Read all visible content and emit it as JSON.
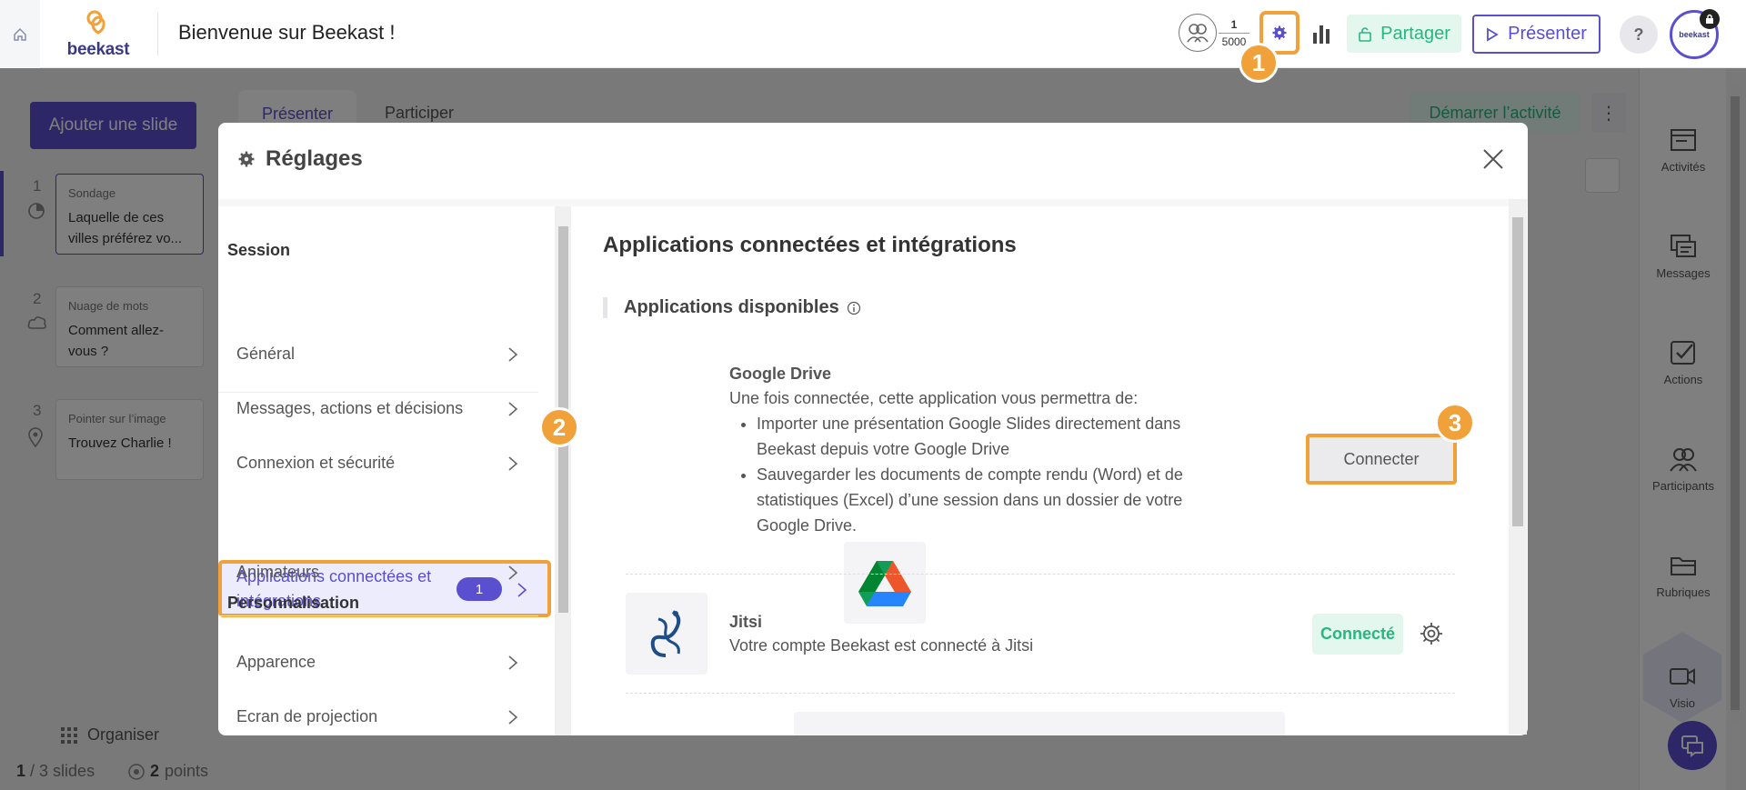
{
  "header": {
    "logo_text": "beekast",
    "title": "Bienvenue sur Beekast !",
    "participants_current": "1",
    "participants_max": "5000",
    "share_label": "Partager",
    "present_label": "Présenter",
    "help_label": "?",
    "avatar_text": "beekast"
  },
  "workspace": {
    "add_slide_label": "Ajouter une slide",
    "tab_present": "Présenter",
    "tab_participate": "Participer",
    "start_activity": "Démarrer l’activité",
    "more_label": "⋮",
    "organise_label": "Organiser",
    "footer_slides_current": "1",
    "footer_slides_total": "/ 3 slides",
    "footer_points_value": "2",
    "footer_points_label": "points",
    "slides": [
      {
        "num": "1",
        "category": "Sondage",
        "question": "Laquelle de ces villes préférez vo..."
      },
      {
        "num": "2",
        "category": "Nuage de mots",
        "question": "Comment allez-vous ?"
      },
      {
        "num": "3",
        "category": "Pointer sur l’image",
        "question": "Trouvez Charlie !"
      }
    ],
    "rail": [
      {
        "label": "Activités",
        "icon": "activities-icon"
      },
      {
        "label": "Messages",
        "icon": "messages-icon"
      },
      {
        "label": "Actions",
        "icon": "actions-icon"
      },
      {
        "label": "Participants",
        "icon": "participants-icon"
      },
      {
        "label": "Rubriques",
        "icon": "folder-icon"
      },
      {
        "label": "Visio",
        "icon": "video-icon"
      }
    ]
  },
  "modal": {
    "title": "Réglages",
    "sections": [
      {
        "title": "Session"
      },
      {
        "title": "Personnalisation"
      }
    ],
    "menu": [
      {
        "label": "Général"
      },
      {
        "label": "Messages, actions et décisions"
      },
      {
        "label": "Connexion et sécurité"
      },
      {
        "label": "Applications connectées et intégrations",
        "badge": "1"
      },
      {
        "label": "Animateurs"
      },
      {
        "label": "Apparence"
      },
      {
        "label": "Ecran de projection"
      }
    ],
    "content_title": "Applications connectées et intégrations",
    "apps_heading": "Applications disponibles",
    "google": {
      "name": "Google Drive",
      "intro": "Une fois connectée, cette application vous permettra de:",
      "bullets": [
        "Importer une présentation Google Slides directement dans Beekast depuis votre Google Drive",
        "Sauvegarder les documents de compte rendu (Word) et de statistiques (Excel) d’une session dans un dossier de votre Google Drive."
      ],
      "button": "Connecter"
    },
    "jitsi": {
      "name": "Jitsi",
      "desc": "Votre compte Beekast est connecté à Jitsi",
      "status": "Connecté"
    }
  },
  "steps": [
    "1",
    "2",
    "3"
  ],
  "colors": {
    "accent": "#5a4fcf",
    "highlight": "#f0a13a",
    "success": "#26b77f"
  }
}
